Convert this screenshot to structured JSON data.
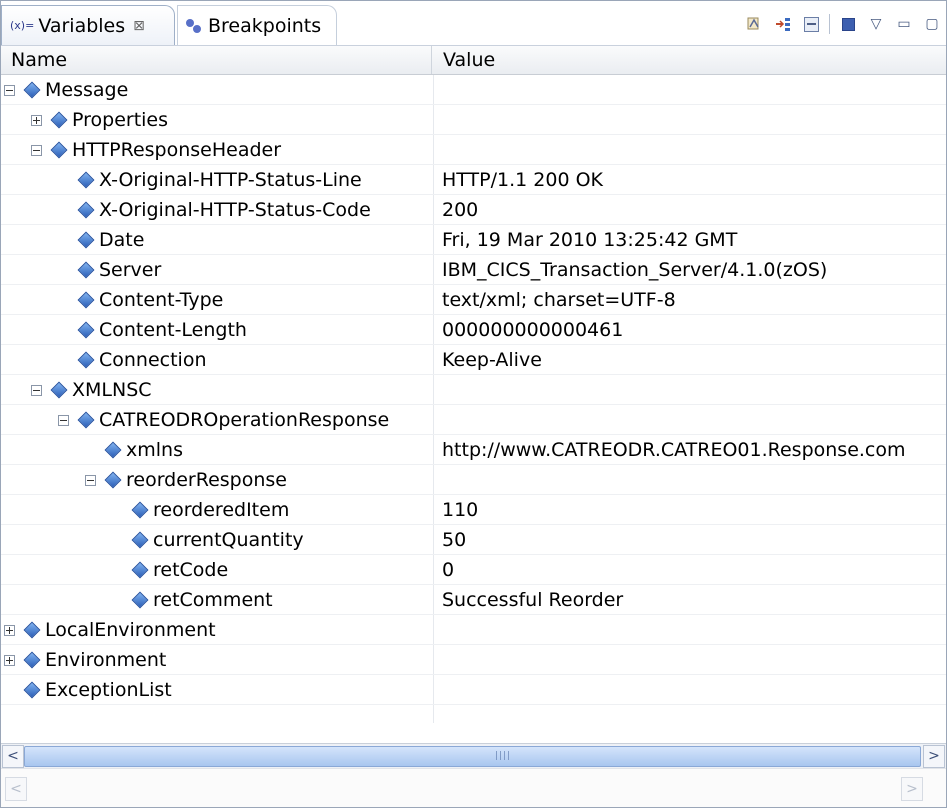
{
  "tabs": {
    "variables": {
      "icon": "variables-icon",
      "icon_text": "(x)=",
      "label": "Variables",
      "close": "⊠"
    },
    "breakpoints": {
      "icon": "breakpoints-icon",
      "label": "Breakpoints"
    }
  },
  "columns": {
    "name": "Name",
    "value": "Value"
  },
  "rows": [
    {
      "toggle": "minus",
      "name": "Message",
      "value": ""
    },
    {
      "toggle": "plus",
      "name": "Properties",
      "value": ""
    },
    {
      "toggle": "minus",
      "name": "HTTPResponseHeader",
      "value": ""
    },
    {
      "toggle": "none",
      "name": "X-Original-HTTP-Status-Line",
      "value": "HTTP/1.1 200 OK"
    },
    {
      "toggle": "none",
      "name": "X-Original-HTTP-Status-Code",
      "value": "200"
    },
    {
      "toggle": "none",
      "name": "Date",
      "value": "Fri, 19 Mar 2010 13:25:42 GMT"
    },
    {
      "toggle": "none",
      "name": "Server",
      "value": "IBM_CICS_Transaction_Server/4.1.0(zOS)"
    },
    {
      "toggle": "none",
      "name": "Content-Type",
      "value": "text/xml; charset=UTF-8"
    },
    {
      "toggle": "none",
      "name": "Content-Length",
      "value": "000000000000461"
    },
    {
      "toggle": "none",
      "name": "Connection",
      "value": "Keep-Alive"
    },
    {
      "toggle": "minus",
      "name": "XMLNSC",
      "value": ""
    },
    {
      "toggle": "minus",
      "name": "CATREODROperationResponse",
      "value": ""
    },
    {
      "toggle": "none",
      "name": "xmlns",
      "value": "http://www.CATREODR.CATREO01.Response.com"
    },
    {
      "toggle": "minus",
      "name": "reorderResponse",
      "value": ""
    },
    {
      "toggle": "none",
      "name": "reorderedItem",
      "value": "110"
    },
    {
      "toggle": "none",
      "name": "currentQuantity",
      "value": "50"
    },
    {
      "toggle": "none",
      "name": "retCode",
      "value": "0"
    },
    {
      "toggle": "none",
      "name": "retComment",
      "value": "Successful Reorder"
    },
    {
      "toggle": "plus",
      "name": "LocalEnvironment",
      "value": ""
    },
    {
      "toggle": "plus",
      "name": "Environment",
      "value": ""
    },
    {
      "toggle": "none",
      "name": "ExceptionList",
      "value": ""
    }
  ],
  "scroll": {
    "left": "<",
    "right": ">"
  }
}
